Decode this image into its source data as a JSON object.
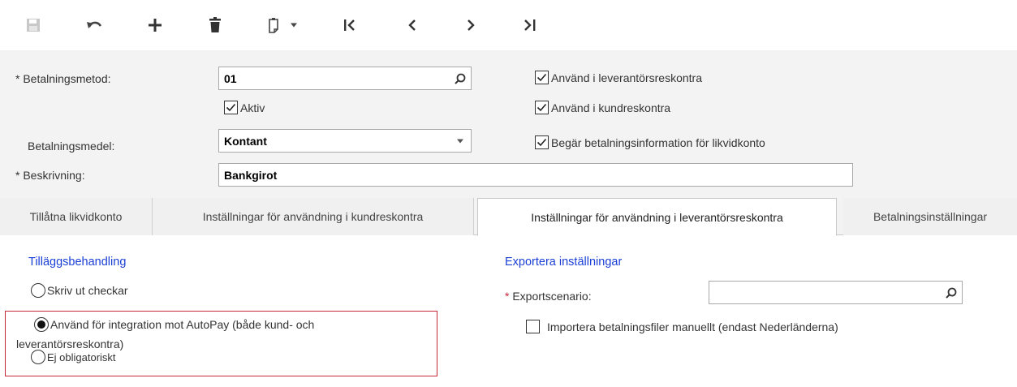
{
  "toolbar": {
    "icons": [
      "save-icon",
      "undo-icon",
      "add-icon",
      "delete-icon",
      "copy-paste-icon",
      "dropdown-arrow-icon",
      "first-record-icon",
      "previous-record-icon",
      "next-record-icon",
      "last-record-icon"
    ]
  },
  "form": {
    "payment_method": {
      "label": "Betalningsmetod:",
      "required_mark": "*",
      "value": "01"
    },
    "active": {
      "label": "Aktiv",
      "checked": true
    },
    "payment_means": {
      "label": "Betalningsmedel:",
      "value": "Kontant"
    },
    "description": {
      "label": "Beskrivning:",
      "required_mark": "*",
      "value": "Bankgirot"
    },
    "use_in_ap": {
      "label": "Använd i leverantörsreskontra",
      "checked": true
    },
    "use_in_ar": {
      "label": "Använd i kundreskontra",
      "checked": true
    },
    "require_payment_info": {
      "label": "Begär betalningsinformation för likvidkonto",
      "checked": true
    }
  },
  "tabs": [
    {
      "label": "Tillåtna likvidkonto",
      "active": false
    },
    {
      "label": "Inställningar för användning i kundreskontra",
      "active": false
    },
    {
      "label": "Inställningar för användning i leverantörsreskontra",
      "active": true
    },
    {
      "label": "Betalningsinställningar",
      "active": false
    }
  ],
  "content": {
    "additional_processing": {
      "title": "Tilläggsbehandling",
      "options": [
        {
          "label": "Skriv ut checkar",
          "selected": false
        },
        {
          "label": "Använd för integration mot AutoPay (både kund- och",
          "label_line2": "leverantörsreskontra)",
          "selected": true
        },
        {
          "label": "Ej obligatoriskt",
          "selected": false
        }
      ]
    },
    "export_settings": {
      "title": "Exportera inställningar",
      "export_scenario": {
        "label": "Exportscenario:",
        "required_mark": "*",
        "value": ""
      },
      "import_manually": {
        "label": "Importera betalningsfiler manuellt (endast Nederländerna)",
        "checked": false
      }
    }
  },
  "colors": {
    "link_blue": "#1a3fd6",
    "required_red": "#c8283a",
    "highlight_border": "#c8283a",
    "form_background": "#f3f3f3"
  }
}
